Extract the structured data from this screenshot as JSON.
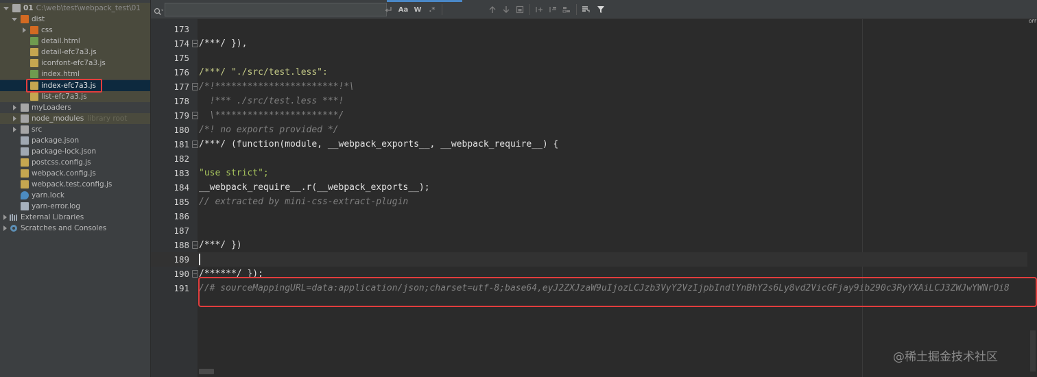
{
  "project_tree": {
    "items": [
      {
        "label": "01",
        "path": "C:\\web\\test\\webpack_test\\01",
        "kind": "root-folder"
      },
      {
        "label": "dist",
        "kind": "folder"
      },
      {
        "label": "css",
        "kind": "folder"
      },
      {
        "label": "detail.html",
        "kind": "html"
      },
      {
        "label": "detail-efc7a3.js",
        "kind": "js"
      },
      {
        "label": "iconfont-efc7a3.js",
        "kind": "js"
      },
      {
        "label": "index.html",
        "kind": "html"
      },
      {
        "label": "index-efc7a3.js",
        "kind": "js",
        "selected": true
      },
      {
        "label": "list-efc7a3.js",
        "kind": "js"
      },
      {
        "label": "myLoaders",
        "kind": "folder"
      },
      {
        "label": "node_modules",
        "hint": "library root",
        "kind": "folder"
      },
      {
        "label": "src",
        "kind": "folder"
      },
      {
        "label": "package.json",
        "kind": "json"
      },
      {
        "label": "package-lock.json",
        "kind": "json"
      },
      {
        "label": "postcss.config.js",
        "kind": "js"
      },
      {
        "label": "webpack.config.js",
        "kind": "js"
      },
      {
        "label": "webpack.test.config.js",
        "kind": "js"
      },
      {
        "label": "yarn.lock",
        "kind": "yarn"
      },
      {
        "label": "yarn-error.log",
        "kind": "file"
      },
      {
        "label": "External Libraries",
        "kind": "libraries"
      },
      {
        "label": "Scratches and Consoles",
        "kind": "scratches"
      }
    ]
  },
  "search_toolbar": {
    "match_case_label": "Aa",
    "words_label": "W",
    "regex_label": ".*"
  },
  "editor": {
    "scroll_indicator": "OFF",
    "lines": [
      {
        "num": "173",
        "text": ""
      },
      {
        "num": "174",
        "text": "/***/ }),"
      },
      {
        "num": "175",
        "text": ""
      },
      {
        "num": "176",
        "text": "/***/ \"./src/test.less\":"
      },
      {
        "num": "177",
        "text": "/*!***********************!*\\"
      },
      {
        "num": "178",
        "text": "  !*** ./src/test.less ***!"
      },
      {
        "num": "179",
        "text": "  \\***********************/"
      },
      {
        "num": "180",
        "text": "/*! no exports provided */"
      },
      {
        "num": "181",
        "text": "/***/ (function(module, __webpack_exports__, __webpack_require__) {"
      },
      {
        "num": "182",
        "text": ""
      },
      {
        "num": "183",
        "text": "\"use strict\";"
      },
      {
        "num": "184",
        "text": "__webpack_require__.r(__webpack_exports__);"
      },
      {
        "num": "185",
        "text": "// extracted by mini-css-extract-plugin"
      },
      {
        "num": "186",
        "text": ""
      },
      {
        "num": "187",
        "text": ""
      },
      {
        "num": "188",
        "text": "/***/ })"
      },
      {
        "num": "189",
        "text": ""
      },
      {
        "num": "190",
        "text": "/******/ });"
      },
      {
        "num": "191",
        "text": "//# sourceMappingURL=data:application/json;charset=utf-8;base64,eyJ2ZXJzaW9uIjozLCJzb3VyY2VzIjpbIndlYnBhY2s6Ly8vd2VicGFjay9ib290c3RyYXAiLCJ3ZWJwYWNrOi8"
      }
    ]
  },
  "watermark": "@稀土掘金技术社区",
  "colors": {
    "highlight_box": "#e23d3d",
    "selection_row": "#0d293e",
    "editor_bg": "#2b2b2b",
    "panel_bg": "#3c3f41"
  }
}
